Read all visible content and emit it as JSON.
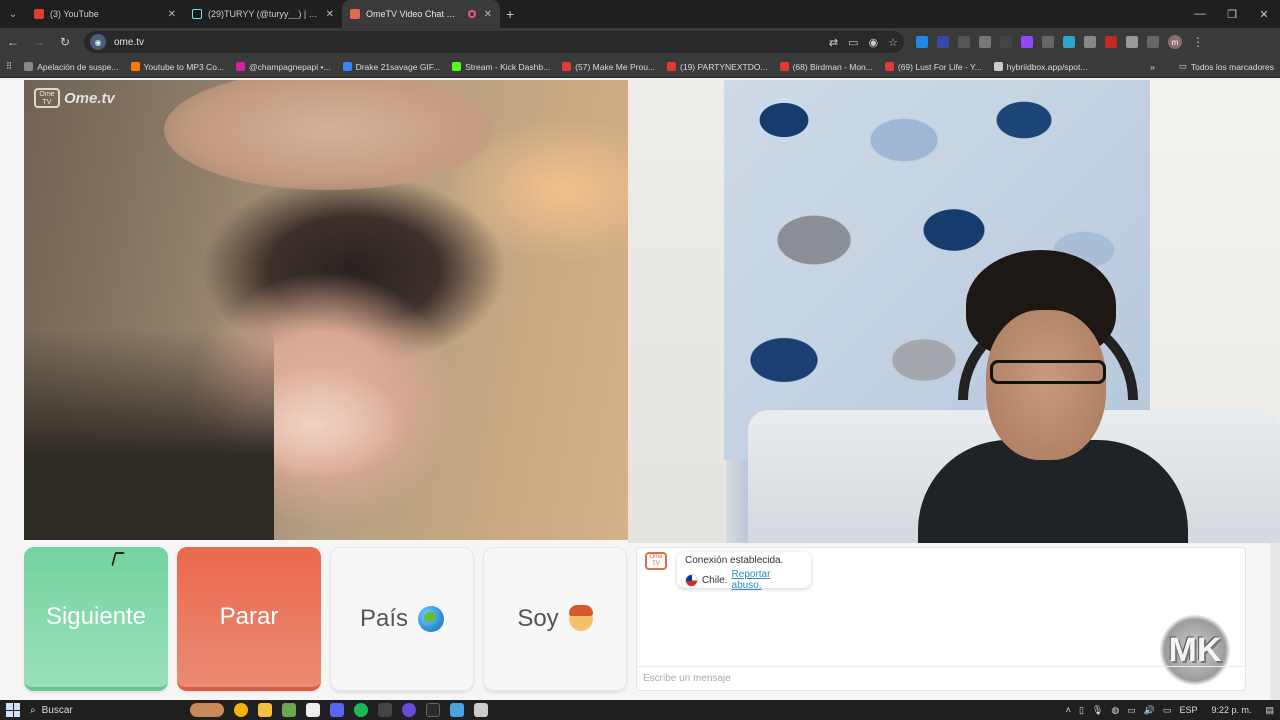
{
  "browser": {
    "tabs": [
      {
        "title": "(3) YouTube",
        "color": "#e53935",
        "active": false
      },
      {
        "title": "(29)TURYY (@turyy__) | TikTok",
        "color": "#111111",
        "active": false
      },
      {
        "title": "OmeTV Video Chat — Ome",
        "color": "#e06a4a",
        "active": true
      }
    ],
    "url": "ome.tv",
    "bookmarks": [
      {
        "label": "Apelación de suspe...",
        "color": "#888888"
      },
      {
        "label": "Youtube to MP3 Co...",
        "color": "#ff7a00"
      },
      {
        "label": "@champagnepapi •...",
        "color": "#d6249f"
      },
      {
        "label": "Drake 21savage GIF...",
        "color": "#3b82f6"
      },
      {
        "label": "Stream - Kick Dashb...",
        "color": "#53fc18"
      },
      {
        "label": "(57) Make Me Prou...",
        "color": "#e53935"
      },
      {
        "label": "(19) PARTYNEXTDO...",
        "color": "#e53935"
      },
      {
        "label": "(68) Birdman - Mon...",
        "color": "#e53935"
      },
      {
        "label": "(69) Lust For Life - Y...",
        "color": "#e53935"
      },
      {
        "label": "hybriidbox.app/spot...",
        "color": "#cccccc"
      }
    ],
    "all_bookmarks": "Todos los marcadores",
    "profile_initial": "m"
  },
  "page": {
    "logo_text": "Ome.tv",
    "buttons": {
      "next": "Siguiente",
      "stop": "Parar",
      "country": "País",
      "gender": "Soy"
    },
    "chat": {
      "status": "Conexión establecida.",
      "country": "Chile.",
      "report": "Reportar abuso.",
      "input_placeholder": "Escribe un mensaje"
    },
    "watermark": "MK"
  },
  "taskbar": {
    "search": "Buscar",
    "lang": "ESP",
    "time": "9:22 p. m."
  }
}
